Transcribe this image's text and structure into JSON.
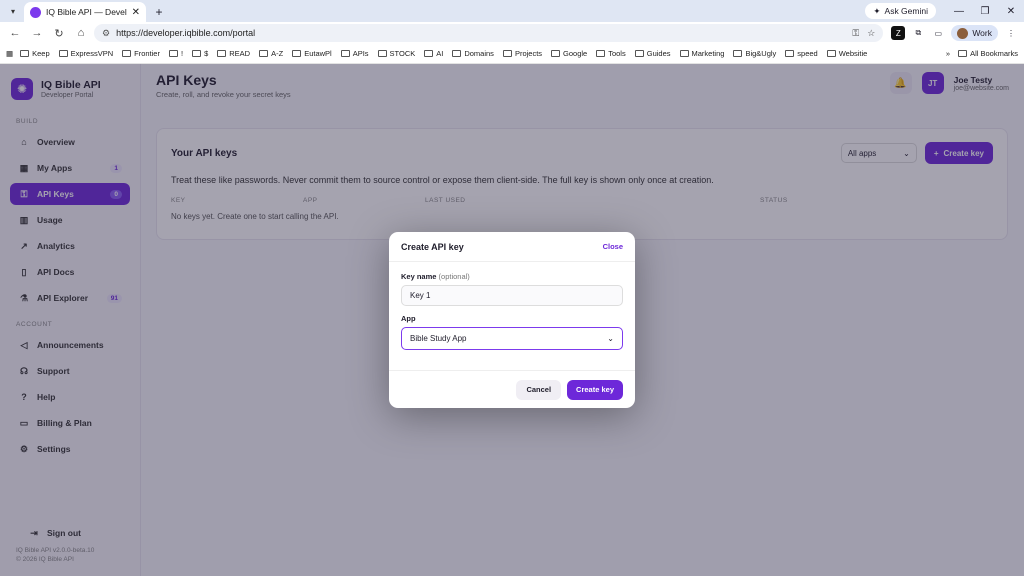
{
  "browser": {
    "tab_title": "IQ Bible API — Developer Portal",
    "url": "https://developer.iqbible.com/portal",
    "ask_gemini": "Ask Gemini",
    "profile": "Work",
    "bookmarks": [
      "Keep",
      "ExpressVPN",
      "Frontier",
      "!",
      "$",
      "READ",
      "A-Z",
      "EutawPl",
      "APIs",
      "STOCK",
      "AI",
      "Domains",
      "Projects",
      "Google",
      "Tools",
      "Guides",
      "Marketing",
      "Big&Ugly",
      "speed",
      "Websitie"
    ],
    "all_bookmarks": "All Bookmarks"
  },
  "brand": {
    "title": "IQ Bible API",
    "subtitle": "Developer Portal"
  },
  "sidebar": {
    "build_label": "BUILD",
    "account_label": "ACCOUNT",
    "build_items": [
      {
        "label": "Overview",
        "icon": "home-icon"
      },
      {
        "label": "My Apps",
        "icon": "grid-icon",
        "badge": "1"
      },
      {
        "label": "API Keys",
        "icon": "key-icon",
        "badge": "0"
      },
      {
        "label": "Usage",
        "icon": "bar-chart-icon"
      },
      {
        "label": "Analytics",
        "icon": "analytics-icon"
      },
      {
        "label": "API Docs",
        "icon": "book-icon"
      },
      {
        "label": "API Explorer",
        "icon": "flask-icon",
        "badge": "91"
      }
    ],
    "account_items": [
      {
        "label": "Announcements",
        "icon": "megaphone-icon"
      },
      {
        "label": "Support",
        "icon": "headset-icon"
      },
      {
        "label": "Help",
        "icon": "help-icon"
      },
      {
        "label": "Billing & Plan",
        "icon": "card-icon"
      },
      {
        "label": "Settings",
        "icon": "gear-icon"
      }
    ],
    "sign_out": "Sign out",
    "version": "IQ Bible API v2.0.0-beta.10",
    "copyright": "© 2026 IQ Bible API"
  },
  "header": {
    "title": "API Keys",
    "subtitle": "Create, roll, and revoke your secret keys",
    "user_initials": "JT",
    "user_name": "Joe Testy",
    "user_email": "joe@website.com"
  },
  "card": {
    "title": "Your API keys",
    "filter": "All apps",
    "create_button": "Create key",
    "warning": "Treat these like passwords. Never commit them to source control or expose them client-side. The full key is shown only once at creation.",
    "columns": [
      "KEY",
      "APP",
      "LAST USED",
      "STATUS"
    ],
    "empty": "No keys yet. Create one to start calling the API."
  },
  "modal": {
    "title": "Create API key",
    "close": "Close",
    "key_name_label": "Key name",
    "key_name_optional": "(optional)",
    "key_name_value": "Key 1",
    "app_label": "App",
    "app_value": "Bible Study App",
    "cancel": "Cancel",
    "create": "Create key"
  }
}
